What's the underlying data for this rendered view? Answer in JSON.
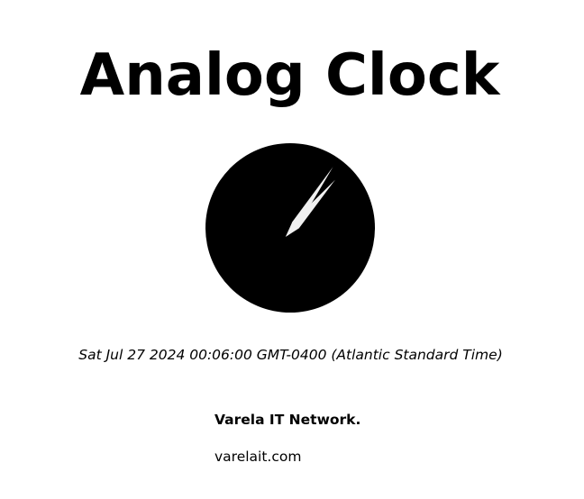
{
  "page": {
    "title": "Analog Clock",
    "datetime": "Sat Jul 27 2024 00:06:00 GMT-0400 (Atlantic Standard Time)"
  },
  "clock": {
    "hours": 0,
    "minutes": 6,
    "seconds": 0,
    "face_color": "#000000",
    "hand_color": "#f0f0f0"
  },
  "footer": {
    "company": "Varela IT Network.",
    "website": "varelait.com"
  }
}
